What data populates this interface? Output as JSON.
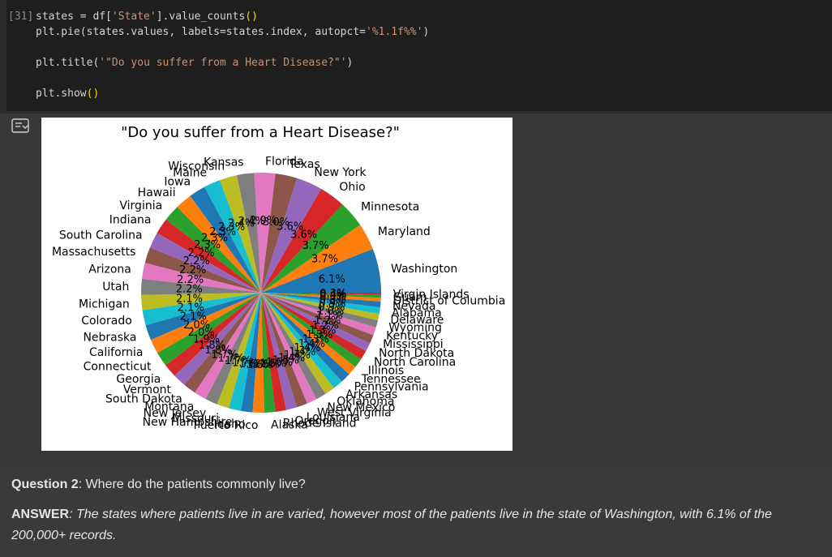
{
  "code_cell": {
    "exec_count": "[31]",
    "lines": [
      "states = df['State'].value_counts()",
      "plt.pie(states.values, labels=states.index, autopct='%1.1f%%')",
      "",
      "plt.title('\"Do you suffer from a Heart Disease?\"')",
      "",
      "plt.show()"
    ]
  },
  "output": {
    "icon": "output-toggle-icon"
  },
  "chart_data": {
    "type": "pie",
    "title": "\"Do you suffer from a Heart Disease?\"",
    "start_angle_deg": 0,
    "direction": "counterclockwise",
    "slices": [
      {
        "label": "Washington",
        "pct": 6.1,
        "pct_label": "6.1%",
        "color": "#1f77b4"
      },
      {
        "label": "Maryland",
        "pct": 3.7,
        "pct_label": "3.7%",
        "color": "#ff7f0e"
      },
      {
        "label": "Minnesota",
        "pct": 3.7,
        "pct_label": "3.7%",
        "color": "#2ca02c"
      },
      {
        "label": "Ohio",
        "pct": 3.6,
        "pct_label": "3.6%",
        "color": "#d62728"
      },
      {
        "label": "New York",
        "pct": 3.6,
        "pct_label": "3.6%",
        "color": "#9467bd"
      },
      {
        "label": "Texas",
        "pct": 3.0,
        "pct_label": "3.0%",
        "color": "#8c564b"
      },
      {
        "label": "Florida",
        "pct": 2.9,
        "pct_label": "2.9%",
        "color": "#e377c2"
      },
      {
        "label": "Kansas",
        "pct": 2.4,
        "pct_label": "2.4%",
        "color": "#7f7f7f"
      },
      {
        "label": "Wisconsin",
        "pct": 2.4,
        "pct_label": "2.4%",
        "color": "#bcbd22"
      },
      {
        "label": "Maine",
        "pct": 2.3,
        "pct_label": "2.3%",
        "color": "#17becf"
      },
      {
        "label": "Iowa",
        "pct": 2.3,
        "pct_label": "2.3%",
        "color": "#1f77b4"
      },
      {
        "label": "Hawaii",
        "pct": 2.3,
        "pct_label": "2.3%",
        "color": "#ff7f0e"
      },
      {
        "label": "Virginia",
        "pct": 2.3,
        "pct_label": "2.3%",
        "color": "#2ca02c"
      },
      {
        "label": "Indiana",
        "pct": 2.2,
        "pct_label": "2.2%",
        "color": "#d62728"
      },
      {
        "label": "South Carolina",
        "pct": 2.2,
        "pct_label": "2.2%",
        "color": "#9467bd"
      },
      {
        "label": "Massachusetts",
        "pct": 2.2,
        "pct_label": "2.2%",
        "color": "#8c564b"
      },
      {
        "label": "Arizona",
        "pct": 2.2,
        "pct_label": "2.2%",
        "color": "#e377c2"
      },
      {
        "label": "Utah",
        "pct": 2.2,
        "pct_label": "2.2%",
        "color": "#7f7f7f"
      },
      {
        "label": "Michigan",
        "pct": 2.1,
        "pct_label": "2.1%",
        "color": "#bcbd22"
      },
      {
        "label": "Colorado",
        "pct": 2.1,
        "pct_label": "2.1%",
        "color": "#17becf"
      },
      {
        "label": "Nebraska",
        "pct": 2.1,
        "pct_label": "2.1%",
        "color": "#1f77b4"
      },
      {
        "label": "California",
        "pct": 2.0,
        "pct_label": "2.0%",
        "color": "#ff7f0e"
      },
      {
        "label": "Connecticut",
        "pct": 2.0,
        "pct_label": "2.0%",
        "color": "#2ca02c"
      },
      {
        "label": "Georgia",
        "pct": 1.9,
        "pct_label": "1.9%",
        "color": "#d62728"
      },
      {
        "label": "Vermont",
        "pct": 1.8,
        "pct_label": "1.8%",
        "color": "#9467bd"
      },
      {
        "label": "South Dakota",
        "pct": 1.8,
        "pct_label": "1.8%",
        "color": "#8c564b"
      },
      {
        "label": "Montana",
        "pct": 1.7,
        "pct_label": "1.7%",
        "color": "#e377c2"
      },
      {
        "label": "New Jersey",
        "pct": 1.7,
        "pct_label": "1.7%",
        "color": "#7f7f7f"
      },
      {
        "label": "Missouri",
        "pct": 1.7,
        "pct_label": "1.7%",
        "color": "#bcbd22"
      },
      {
        "label": "New Hampshire",
        "pct": 1.7,
        "pct_label": "1.7%",
        "color": "#17becf"
      },
      {
        "label": "Idaho",
        "pct": 1.6,
        "pct_label": "1.6%",
        "color": "#1f77b4"
      },
      {
        "label": "Puerto Rico",
        "pct": 1.6,
        "pct_label": "1.6%",
        "color": "#ff7f0e"
      },
      {
        "label": "Alaska",
        "pct": 1.5,
        "pct_label": "1.5%",
        "color": "#2ca02c"
      },
      {
        "label": "Rhode Island",
        "pct": 1.5,
        "pct_label": "1.5%",
        "color": "#d62728"
      },
      {
        "label": "Oregon",
        "pct": 1.5,
        "pct_label": "1.5%",
        "color": "#9467bd"
      },
      {
        "label": "Louisiana",
        "pct": 1.5,
        "pct_label": "1.5%",
        "color": "#8c564b"
      },
      {
        "label": "West Virginia",
        "pct": 1.4,
        "pct_label": "1.4%",
        "color": "#e377c2"
      },
      {
        "label": "New Mexico",
        "pct": 1.4,
        "pct_label": "1.4%",
        "color": "#7f7f7f"
      },
      {
        "label": "Oklahoma",
        "pct": 1.4,
        "pct_label": "1.4%",
        "color": "#bcbd22"
      },
      {
        "label": "Arkansas",
        "pct": 1.4,
        "pct_label": "1.4%",
        "color": "#17becf"
      },
      {
        "label": "Pennsylvania",
        "pct": 1.4,
        "pct_label": "1.4%",
        "color": "#1f77b4"
      },
      {
        "label": "Tennessee",
        "pct": 1.3,
        "pct_label": "1.3%",
        "color": "#ff7f0e"
      },
      {
        "label": "Illinois",
        "pct": 1.3,
        "pct_label": "1.3%",
        "color": "#2ca02c"
      },
      {
        "label": "North Carolina",
        "pct": 1.3,
        "pct_label": "1.3%",
        "color": "#d62728"
      },
      {
        "label": "North Dakota",
        "pct": 1.2,
        "pct_label": "1.2%",
        "color": "#9467bd"
      },
      {
        "label": "Mississippi",
        "pct": 1.2,
        "pct_label": "1.2%",
        "color": "#8c564b"
      },
      {
        "label": "Kentucky",
        "pct": 1.1,
        "pct_label": "1.1%",
        "color": "#e377c2"
      },
      {
        "label": "Wyoming",
        "pct": 1.0,
        "pct_label": "1.0%",
        "color": "#7f7f7f"
      },
      {
        "label": "Delaware",
        "pct": 0.9,
        "pct_label": "0.9%",
        "color": "#bcbd22"
      },
      {
        "label": "Alabama",
        "pct": 0.9,
        "pct_label": "0.9%",
        "color": "#17becf"
      },
      {
        "label": "Nevada",
        "pct": 0.8,
        "pct_label": "0.8%",
        "color": "#1f77b4"
      },
      {
        "label": "District of Columbia",
        "pct": 0.5,
        "pct_label": "0.5%",
        "color": "#ff7f0e"
      },
      {
        "label": "Guam",
        "pct": 0.4,
        "pct_label": "0.4%",
        "color": "#2ca02c"
      },
      {
        "label": "Virgin Islands",
        "pct": 0.3,
        "pct_label": "0.3%",
        "color": "#d62728"
      }
    ]
  },
  "text_cell": {
    "question_label": "Question 2",
    "question_text": ": Where do the patients commonly live?",
    "answer_label": "ANSWER",
    "answer_text": ": The states where patients live in are varied, however most of the patients live in the state of Washington, with 6.1% of the 200,000+ records."
  }
}
